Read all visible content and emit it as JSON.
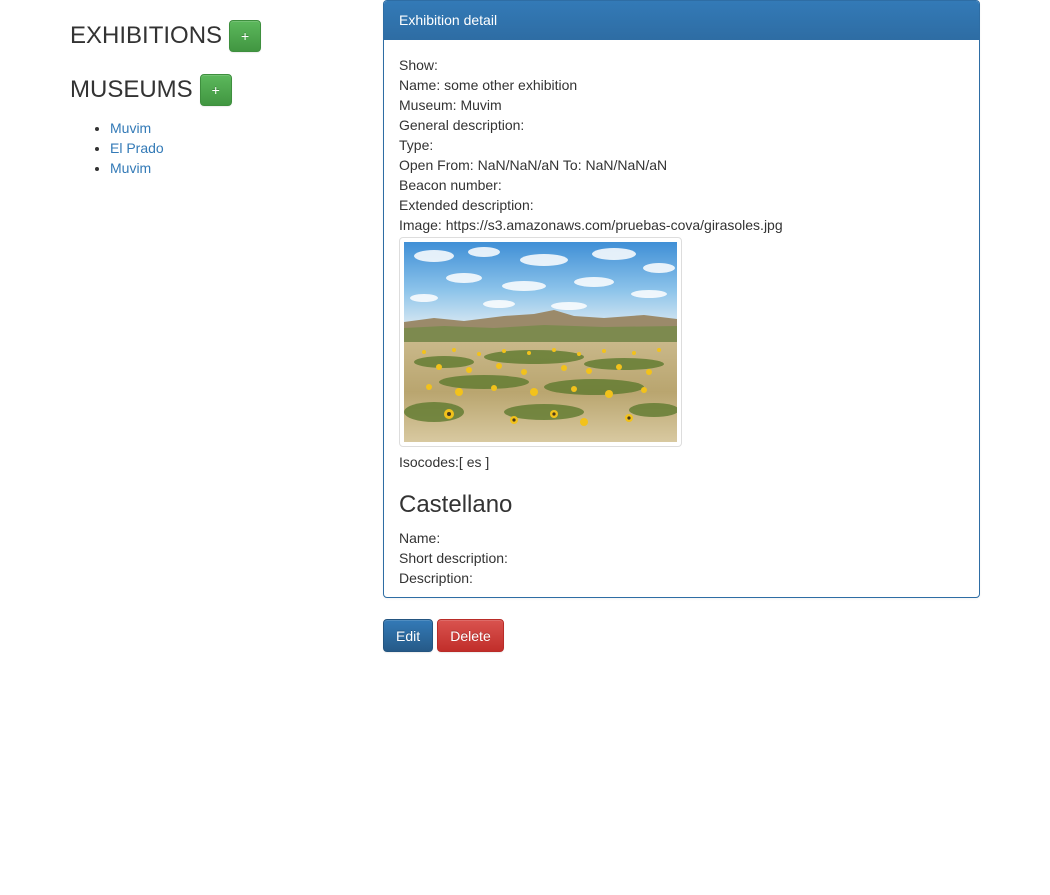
{
  "sidebar": {
    "exhibitions_title": "EXHIBITIONS",
    "museums_title": "MUSEUMS",
    "add_label": "+",
    "museums": [
      "Muvim",
      "El Prado",
      "Muvim"
    ]
  },
  "detail": {
    "heading": "Exhibition detail",
    "show_label": "Show:",
    "name_line": "Name: some other exhibition",
    "museum_line": "Museum: Muvim",
    "general_description_label": "General description:",
    "type_label": "Type:",
    "open_line": "Open From: NaN/NaN/aN To: NaN/NaN/aN",
    "beacon_label": "Beacon number:",
    "extended_description_label": "Extended description:",
    "image_line": "Image: https://s3.amazonaws.com/pruebas-cova/girasoles.jpg",
    "isocodes_line": "Isocodes:[ es ]",
    "language": {
      "title": "Castellano",
      "name_label": "Name:",
      "short_description_label": "Short description:",
      "description_label": "Description:"
    }
  },
  "actions": {
    "edit_label": "Edit",
    "delete_label": "Delete"
  },
  "colors": {
    "primary": "#337ab7",
    "success": "#5cb85c",
    "danger": "#d9534f",
    "link": "#337ab7"
  }
}
